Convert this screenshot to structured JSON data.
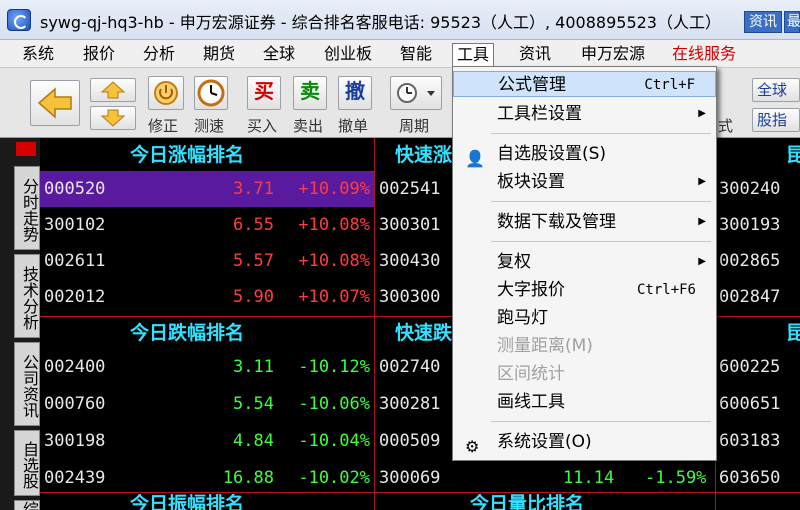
{
  "window": {
    "title": "sywg-qj-hq3-hb - 申万宏源证券 - 综合排名客服电话: 95523（人工）, 4008895523（人工）",
    "btn_news": "资讯",
    "btn_minimize": "最"
  },
  "menu": {
    "items": [
      "系统",
      "报价",
      "分析",
      "期货",
      "全球",
      "创业板",
      "智能",
      "工具",
      "资讯",
      "申万宏源",
      "在线服务"
    ]
  },
  "toolbar": {
    "revise": "修正",
    "speed": "测速",
    "buy_char": "买",
    "buy": "买入",
    "sell_char": "卖",
    "sell": "卖出",
    "cancel_char": "撤",
    "cancel": "撤单",
    "period": "周期",
    "right_btn1": "全球",
    "right_btn2": "股指",
    "right_label": "式"
  },
  "side_tabs": [
    "分时走势",
    "技术分析",
    "公司资讯",
    "自选股",
    "综"
  ],
  "grid": {
    "top_left_title": "今日涨幅排名",
    "top_mid_title": "快速涨",
    "top_right_title": "昆",
    "bottom_left_title": "今日跌幅排名",
    "bottom_mid_title": "快速跌",
    "bottom_right_title": "昆",
    "footer_left": "今日振幅排名",
    "footer_mid": "今日量比排名",
    "gainers": [
      {
        "code": "000520",
        "price": "3.71",
        "pct": "+10.09%"
      },
      {
        "code": "300102",
        "price": "6.55",
        "pct": "+10.08%"
      },
      {
        "code": "002611",
        "price": "5.57",
        "pct": "+10.08%"
      },
      {
        "code": "002012",
        "price": "5.90",
        "pct": "+10.07%"
      }
    ],
    "gainers_mid": [
      "002541",
      "300301",
      "300430",
      "300300"
    ],
    "gainers_right": [
      "300240",
      "300193",
      "002865",
      "002847"
    ],
    "losers": [
      {
        "code": "002400",
        "price": "3.11",
        "pct": "-10.12%"
      },
      {
        "code": "000760",
        "price": "5.54",
        "pct": "-10.06%"
      },
      {
        "code": "300198",
        "price": "4.84",
        "pct": "-10.04%"
      },
      {
        "code": "002439",
        "price": "16.88",
        "pct": "-10.02%"
      }
    ],
    "losers_mid": [
      "002740",
      "300281",
      "000509",
      "300069"
    ],
    "losers_mid_extra": {
      "price": "11.14",
      "pct": "-1.59%"
    },
    "losers_right": [
      "600225",
      "600651",
      "603183",
      "603650"
    ]
  },
  "dropdown": {
    "items": [
      {
        "label": "公式管理",
        "shortcut": "Ctrl+F"
      },
      {
        "label": "工具栏设置"
      },
      {
        "label": "自选股设置(S)"
      },
      {
        "label": "板块设置"
      },
      {
        "label": "数据下载及管理"
      },
      {
        "label": "复权"
      },
      {
        "label": "大字报价",
        "shortcut": "Ctrl+F6"
      },
      {
        "label": "跑马灯"
      },
      {
        "label": "测量距离(M)"
      },
      {
        "label": "区间统计"
      },
      {
        "label": "画线工具"
      },
      {
        "label": "系统设置(O)"
      }
    ]
  }
}
